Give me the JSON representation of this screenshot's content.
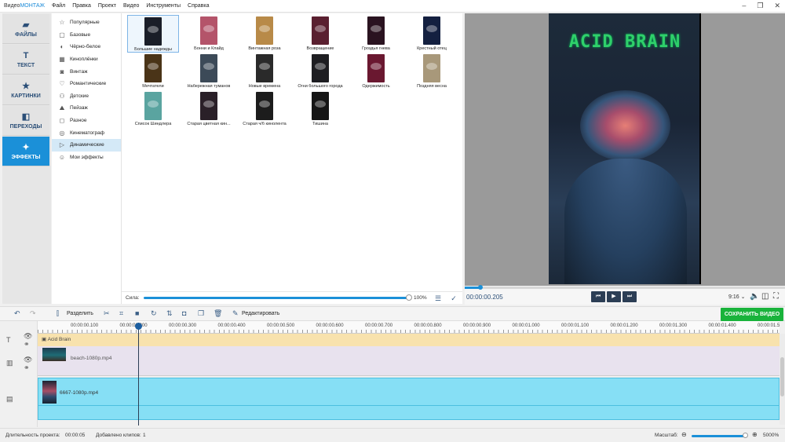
{
  "app": {
    "title_prefix": "Видео",
    "title_brand": "МОНТАЖ",
    "menu": [
      "Файл",
      "Правка",
      "Проект",
      "Видео",
      "Инструменты",
      "Справка"
    ],
    "window_controls": [
      "–",
      "❐",
      "✕"
    ]
  },
  "nav": [
    {
      "label": "ФАЙЛЫ",
      "icon": "files-icon",
      "glyph": "▰",
      "active": false
    },
    {
      "label": "ТЕКСТ",
      "icon": "text-icon",
      "glyph": "T",
      "active": false
    },
    {
      "label": "КАРТИНКИ",
      "icon": "star-icon",
      "glyph": "★",
      "active": false
    },
    {
      "label": "ПЕРЕХОДЫ",
      "icon": "transitions-icon",
      "glyph": "◧",
      "active": false
    },
    {
      "label": "ЭФФЕКТЫ",
      "icon": "magic-wand-icon",
      "glyph": "✦",
      "active": true
    }
  ],
  "categories": [
    {
      "label": "Популярные",
      "glyph": "☆",
      "icon": "star-outline-icon"
    },
    {
      "label": "Базовые",
      "glyph": "▢",
      "icon": "square-icon"
    },
    {
      "label": "Чёрно-белое",
      "glyph": "◐",
      "icon": "half-circle-icon"
    },
    {
      "label": "Киноплёнки",
      "glyph": "▦",
      "icon": "film-icon"
    },
    {
      "label": "Винтаж",
      "glyph": "◙",
      "icon": "camera-icon"
    },
    {
      "label": "Романтические",
      "glyph": "♡",
      "icon": "heart-icon"
    },
    {
      "label": "Детские",
      "glyph": "⚇",
      "icon": "kids-icon"
    },
    {
      "label": "Пейзаж",
      "glyph": "⛰",
      "icon": "landscape-icon"
    },
    {
      "label": "Разное",
      "glyph": "◻",
      "icon": "misc-icon"
    },
    {
      "label": "Кинематограф",
      "glyph": "◎",
      "icon": "cinema-icon"
    },
    {
      "label": "Динамические",
      "glyph": "▷",
      "icon": "dynamic-icon",
      "active": true
    },
    {
      "label": "Мои эффекты",
      "glyph": "☺",
      "icon": "user-icon"
    }
  ],
  "effects": [
    {
      "label": "Большие надежды",
      "color": "#1a1e28",
      "selected": true
    },
    {
      "label": "Бонни и Клайд",
      "color": "#b4546a"
    },
    {
      "label": "Винтажная роза",
      "color": "#b88a48"
    },
    {
      "label": "Возвращение",
      "color": "#5a2030"
    },
    {
      "label": "Гроздья гнева",
      "color": "#2a1320"
    },
    {
      "label": "Крестный отец",
      "color": "#142040"
    },
    {
      "label": "Мечтатели",
      "color": "#4a3418"
    },
    {
      "label": "Набережная туманов",
      "color": "#3c4a58"
    },
    {
      "label": "Новые времена",
      "color": "#2a2a2a"
    },
    {
      "label": "Огни большого города",
      "color": "#1e1e22"
    },
    {
      "label": "Одержимость",
      "color": "#6a1830"
    },
    {
      "label": "Поздняя весна",
      "color": "#a8987a"
    },
    {
      "label": "Список Шиндлера",
      "color": "#5aa4a0"
    },
    {
      "label": "Старая цветная кин...",
      "color": "#2a2028"
    },
    {
      "label": "Старая ч/б кинолента",
      "color": "#1c1c1c"
    },
    {
      "label": "Тишина",
      "color": "#151515"
    }
  ],
  "strength": {
    "label": "Сила:",
    "value_text": "100%",
    "value": 1.0
  },
  "preview": {
    "video_title": "ACID BRAIN",
    "timecode": "00:00:00.205",
    "ratio": "9:16",
    "progress": 0.05
  },
  "toolbar": {
    "split_label": "Разделить",
    "edit_label": "Редактировать",
    "save_label": "СОХРАНИТЬ ВИДЕО"
  },
  "timeline": {
    "ticks": [
      "00:00:00.100",
      "00:00:00.200",
      "00:00:00.300",
      "00:00:00.400",
      "00:00:00.500",
      "00:00:00.600",
      "00:00:00.700",
      "00:00:00.800",
      "00:00:00.900",
      "00:00:01.000",
      "00:00:01.100",
      "00:00:01.200",
      "00:00:01.300",
      "00:00:01.400",
      "00:00:01.5"
    ],
    "text_clip": "Acid Brain",
    "clip1": "beach-1080p.mp4",
    "clip2": "6667-1080p.mp4"
  },
  "status": {
    "duration_label": "Длительность проекта:",
    "duration_value": "00:00:05",
    "clips_label": "Добавлено клипов:",
    "clips_value": "1",
    "zoom_label": "Масштаб:",
    "zoom_value": "5000%",
    "zoom_level": 0.93
  }
}
